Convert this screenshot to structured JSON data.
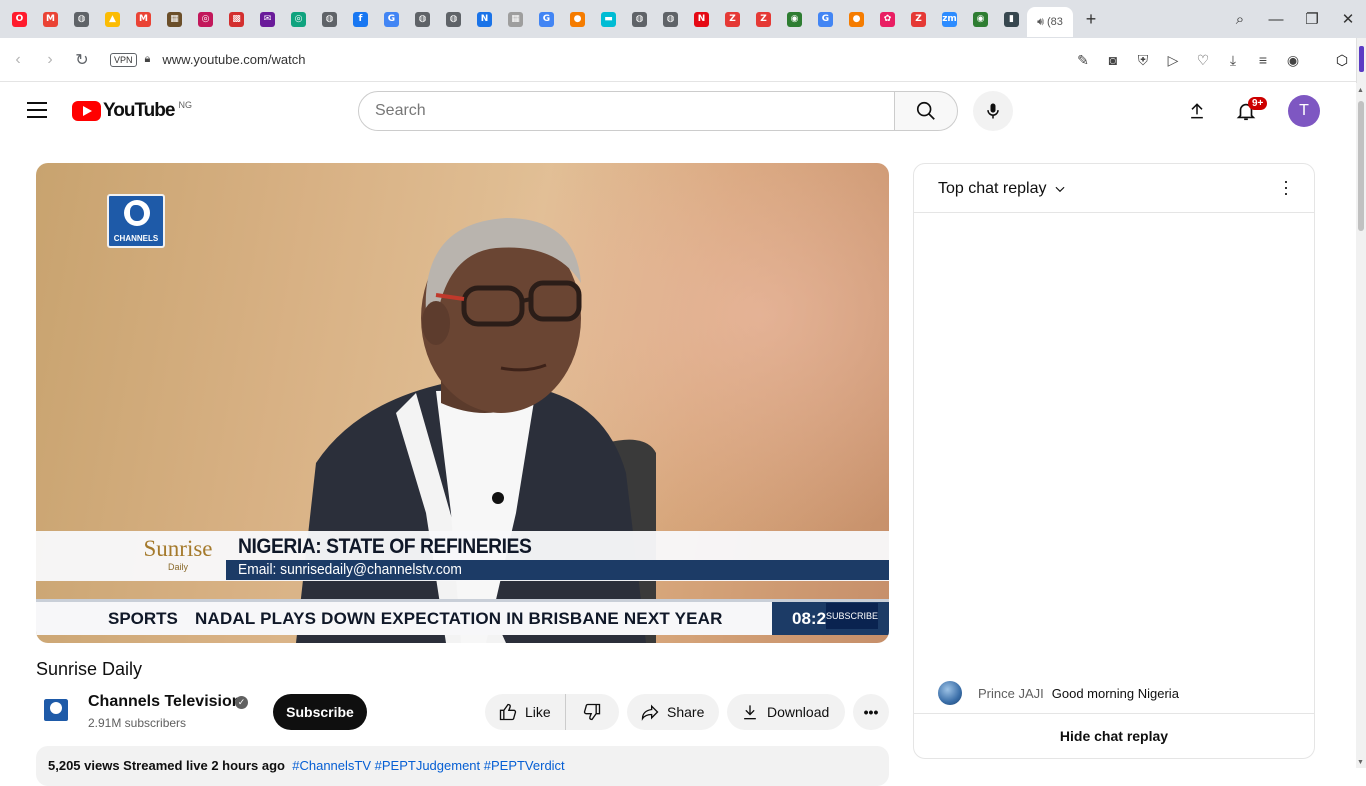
{
  "browser": {
    "tab_icons": [
      {
        "name": "opera-icon",
        "color": "#ff1b2d",
        "glyph": "O"
      },
      {
        "name": "gmail-icon",
        "color": "#ea4335",
        "glyph": "M"
      },
      {
        "name": "globe-icon",
        "color": "#5f6368",
        "glyph": "◍"
      },
      {
        "name": "drive-icon",
        "color": "#fbbc04",
        "glyph": "▲"
      },
      {
        "name": "gmail-icon",
        "color": "#ea4335",
        "glyph": "M"
      },
      {
        "name": "site-icon",
        "color": "#6b4f2a",
        "glyph": "▦"
      },
      {
        "name": "site-icon",
        "color": "#c2185b",
        "glyph": "◎"
      },
      {
        "name": "site-icon",
        "color": "#d32f2f",
        "glyph": "▩"
      },
      {
        "name": "mail-icon",
        "color": "#6a1b9a",
        "glyph": "✉"
      },
      {
        "name": "chatgpt-icon",
        "color": "#10a37f",
        "glyph": "◎"
      },
      {
        "name": "globe-icon",
        "color": "#5f6368",
        "glyph": "◍"
      },
      {
        "name": "facebook-icon",
        "color": "#1877f2",
        "glyph": "f"
      },
      {
        "name": "google-icon",
        "color": "#4285f4",
        "glyph": "G"
      },
      {
        "name": "globe-icon",
        "color": "#5f6368",
        "glyph": "◍"
      },
      {
        "name": "globe-icon",
        "color": "#5f6368",
        "glyph": "◍"
      },
      {
        "name": "n-icon",
        "color": "#1a73e8",
        "glyph": "N"
      },
      {
        "name": "grid-icon",
        "color": "#9e9e9e",
        "glyph": "▦"
      },
      {
        "name": "google-icon",
        "color": "#4285f4",
        "glyph": "G"
      },
      {
        "name": "orange-icon",
        "color": "#f57c00",
        "glyph": "●"
      },
      {
        "name": "cyan-icon",
        "color": "#00bcd4",
        "glyph": "▬"
      },
      {
        "name": "globe-icon",
        "color": "#5f6368",
        "glyph": "◍"
      },
      {
        "name": "globe-icon",
        "color": "#5f6368",
        "glyph": "◍"
      },
      {
        "name": "netflix-icon",
        "color": "#e50914",
        "glyph": "N"
      },
      {
        "name": "z-icon",
        "color": "#e53935",
        "glyph": "Z"
      },
      {
        "name": "z-icon",
        "color": "#e53935",
        "glyph": "Z"
      },
      {
        "name": "green-icon",
        "color": "#2e7d32",
        "glyph": "◉"
      },
      {
        "name": "google-icon",
        "color": "#4285f4",
        "glyph": "G"
      },
      {
        "name": "orange-icon",
        "color": "#f57c00",
        "glyph": "●"
      },
      {
        "name": "colorful-icon",
        "color": "#e91e63",
        "glyph": "✿"
      },
      {
        "name": "z-icon",
        "color": "#e53935",
        "glyph": "Z"
      },
      {
        "name": "zoom-icon",
        "color": "#2d8cff",
        "glyph": "zm"
      },
      {
        "name": "green-icon",
        "color": "#2e7d32",
        "glyph": "◉"
      },
      {
        "name": "chart-icon",
        "color": "#37474f",
        "glyph": "▮"
      }
    ],
    "active_tab_label": "(83",
    "url": "www.youtube.com/watch",
    "vpn_label": "VPN"
  },
  "header": {
    "logo_text": "YouTube",
    "country_code": "NG",
    "search_placeholder": "Search",
    "notification_badge": "9+",
    "avatar_letter": "T"
  },
  "video": {
    "channel_bug": "CHANNELS",
    "show_logo": "Sunrise",
    "show_logo_sub": "Daily",
    "headline": "NIGERIA: STATE OF REFINERIES",
    "email_line": "Email: sunrisedaily@channelstv.com",
    "ticker_label": "SPORTS",
    "ticker_text": "NADAL PLAYS DOWN EXPECTATION IN BRISBANE NEXT YEAR",
    "ticker_time": "08:2",
    "ticker_subscribe": "SUBSCRIBE",
    "title": "Sunrise Daily"
  },
  "channel": {
    "name": "Channels Television",
    "subscribers": "2.91M subscribers",
    "subscribe_label": "Subscribe"
  },
  "actions": {
    "like_label": "Like",
    "share_label": "Share",
    "download_label": "Download"
  },
  "description": {
    "meta": "5,205 views  Streamed live 2 hours ago",
    "tags": "#ChannelsTV #PEPTJudgement #PEPTVerdict"
  },
  "chat": {
    "title": "Top chat replay",
    "messages": [
      {
        "author": "Prince JAJI",
        "text": "Good morning Nigeria"
      }
    ],
    "hide_label": "Hide chat replay"
  }
}
